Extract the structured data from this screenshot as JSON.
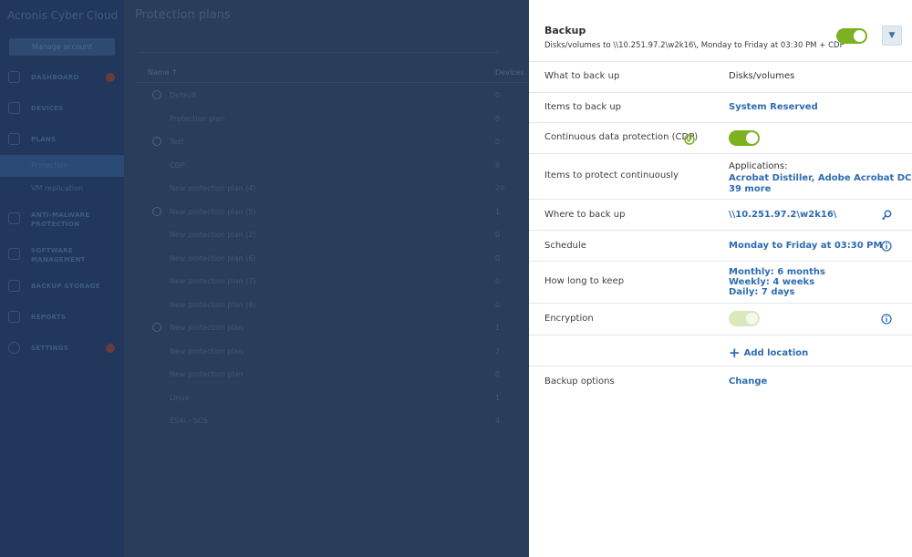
{
  "app": {
    "brand": "Acronis Cyber Cloud",
    "manage_button": "Manage account",
    "nav": [
      {
        "label": "DASHBOARD",
        "badge": true
      },
      {
        "label": "DEVICES",
        "badge": false
      },
      {
        "label": "PLANS",
        "badge": false
      },
      {
        "label": "ANTI-MALWARE PROTECTION",
        "badge": false
      },
      {
        "label": "SOFTWARE MANAGEMENT",
        "badge": false
      },
      {
        "label": "BACKUP STORAGE",
        "badge": false
      },
      {
        "label": "REPORTS",
        "badge": false
      },
      {
        "label": "SETTINGS",
        "badge": true
      }
    ],
    "subnav": [
      {
        "label": "Protection",
        "active": true
      },
      {
        "label": "VM replication",
        "active": false
      }
    ]
  },
  "main": {
    "title": "Protection plans",
    "col_name": "Name ↑",
    "col_devices": "Devices",
    "rows": [
      {
        "name": "Default",
        "count": "0",
        "group": true
      },
      {
        "name": "Protection plan",
        "count": "0",
        "group": false
      },
      {
        "name": "Test",
        "count": "0",
        "group": true
      },
      {
        "name": "CDP",
        "count": "8",
        "group": false
      },
      {
        "name": "New protection plan (4)",
        "count": "20",
        "group": false
      },
      {
        "name": "New protection plan (5)",
        "count": "1",
        "group": true
      },
      {
        "name": "New protection plan (2)",
        "count": "0",
        "group": false
      },
      {
        "name": "New protection plan (6)",
        "count": "0",
        "group": false
      },
      {
        "name": "New protection plan (7)",
        "count": "0",
        "group": false
      },
      {
        "name": "New protection plan (8)",
        "count": "0",
        "group": false
      },
      {
        "name": "New protection plan",
        "count": "1",
        "group": true
      },
      {
        "name": "New protection plan",
        "count": "2",
        "group": false
      },
      {
        "name": "New protection plan",
        "count": "0",
        "group": false
      },
      {
        "name": "Linux",
        "count": "1",
        "group": false
      },
      {
        "name": "ESXi - SCS",
        "count": "4",
        "group": false
      }
    ]
  },
  "panel": {
    "title": "Backup",
    "subtitle": "Disks/volumes to \\\\10.251.97.2\\w2k16\\, Monday to Friday at 03:30 PM + CDP",
    "rows": {
      "what": {
        "label": "What to back up",
        "value": "Disks/volumes"
      },
      "items": {
        "label": "Items to back up",
        "value": "System Reserved"
      },
      "cdp": {
        "label": "Continuous data protection (CDP)"
      },
      "protect": {
        "label": "Items to protect continuously",
        "value_prefix": "Applications:",
        "value_line1": "Acrobat Distiller, Adobe Acrobat DC +",
        "value_line2": "39 more"
      },
      "where": {
        "label": "Where to back up",
        "value": "\\\\10.251.97.2\\w2k16\\"
      },
      "schedule": {
        "label": "Schedule",
        "value": "Monday to Friday at 03:30 PM"
      },
      "keep": {
        "label": "How long to keep",
        "monthly": "Monthly: 6 months",
        "weekly": "Weekly: 4 weeks",
        "daily": "Daily: 7 days"
      },
      "encryption": {
        "label": "Encryption"
      },
      "add_location": "Add location",
      "options": {
        "label": "Backup options",
        "value": "Change"
      }
    }
  },
  "colors": {
    "accent": "#2f6cb1",
    "toggle_on": "#7cb121",
    "toggle_disabled": "#d8e9bb",
    "overlay_bg": "#2b3f5c"
  },
  "icons": {
    "expand": "chevron-down-icon",
    "where": "key-icon",
    "schedule": "info-icon",
    "encryption": "info-icon",
    "cdp": "cdp-refresh-icon"
  }
}
